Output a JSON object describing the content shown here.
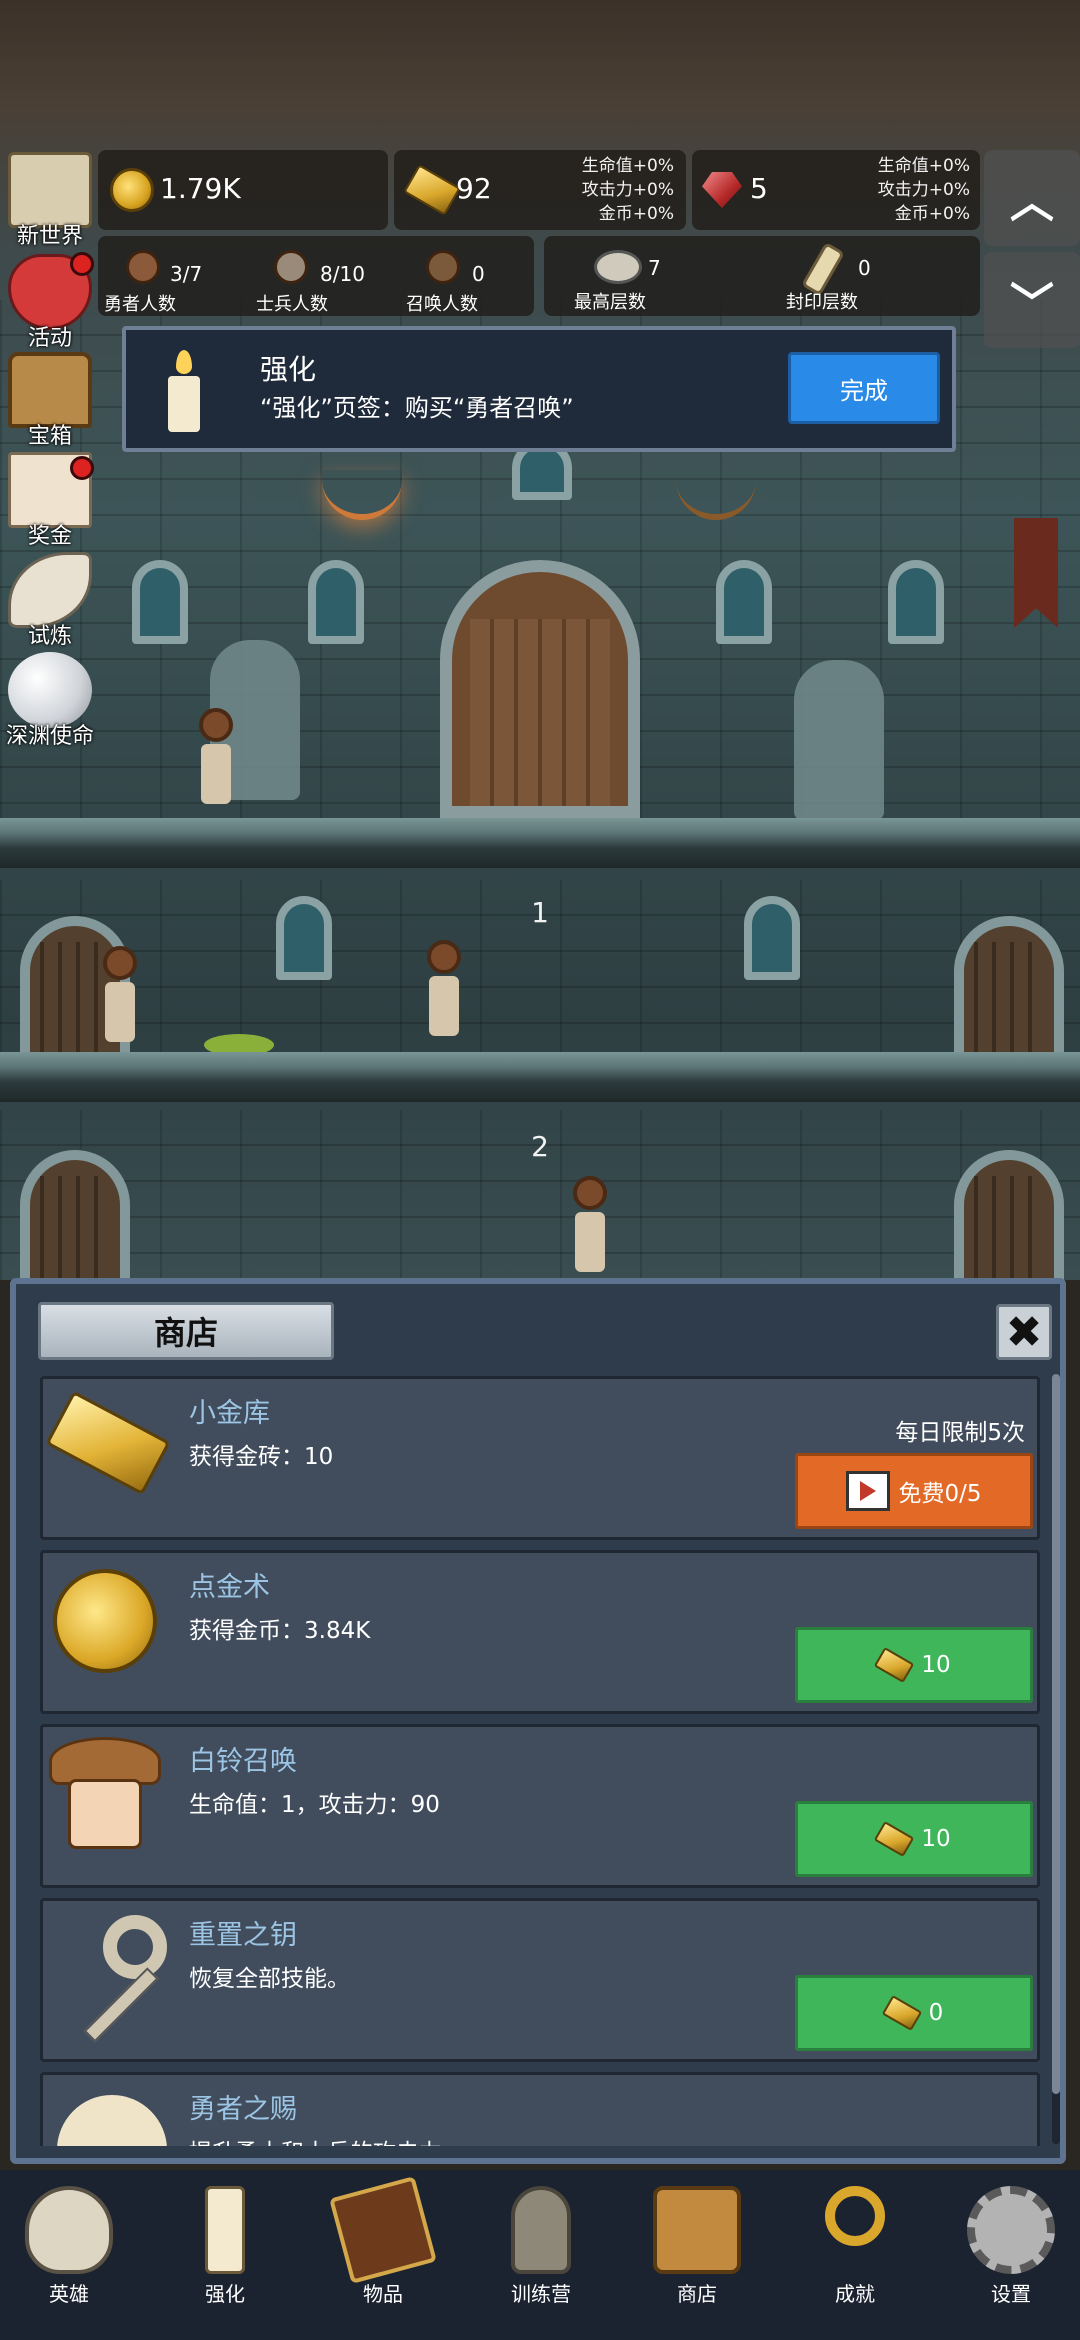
{
  "hud": {
    "gold_coins": "1.79K",
    "gold_bars": "92",
    "gold_bars_bonus": [
      "生命值+0%",
      "攻击力+0%",
      "金币+0%"
    ],
    "gems": "5",
    "gems_bonus": [
      "生命值+0%",
      "攻击力+0%",
      "金币+0%"
    ],
    "counts": [
      {
        "label": "勇者人数",
        "value": "3/7"
      },
      {
        "label": "士兵人数",
        "value": "8/10"
      },
      {
        "label": "召唤人数",
        "value": "0"
      },
      {
        "label": "最高层数",
        "value": "7"
      },
      {
        "label": "封印层数",
        "value": "0"
      }
    ],
    "arrow_up": "︿",
    "arrow_down": "﹀"
  },
  "side_menu": [
    {
      "label": "新世界",
      "icon": "map-scroll-icon",
      "badge": false
    },
    {
      "label": "活动",
      "icon": "heart-icon",
      "badge": true
    },
    {
      "label": "宝箱",
      "icon": "treasure-chest-icon",
      "badge": false
    },
    {
      "label": "奖金",
      "icon": "envelope-icon",
      "badge": true
    },
    {
      "label": "试炼",
      "icon": "feather-icon",
      "badge": false
    },
    {
      "label": "深渊使命",
      "icon": "pearl-icon",
      "badge": false
    }
  ],
  "quest": {
    "title": "强化",
    "description": "“强化”页签：购买“勇者召唤”",
    "button": "完成"
  },
  "floors": [
    "1",
    "2"
  ],
  "shop": {
    "title": "商店",
    "close": "✖",
    "items": [
      {
        "name": "小金库",
        "desc": "获得金砖：10",
        "limit": "每日限制5次",
        "button": "免费0/5",
        "button_type": "video"
      },
      {
        "name": "点金术",
        "desc": "获得金币：3.84K",
        "limit": "",
        "button": "10",
        "button_type": "goldbar"
      },
      {
        "name": "白铃召唤",
        "desc": "生命值：1，攻击力：90",
        "limit": "",
        "button": "10",
        "button_type": "goldbar"
      },
      {
        "name": "重置之钥",
        "desc": "恢复全部技能。",
        "limit": "",
        "button": "0",
        "button_type": "goldbar"
      },
      {
        "name": "勇者之赐",
        "desc": "提升勇士和士兵的攻击力。",
        "limit": "",
        "button": "",
        "button_type": "goldbar"
      }
    ]
  },
  "bottom_nav": [
    {
      "label": "英雄",
      "icon": "skull-icon"
    },
    {
      "label": "强化",
      "icon": "candle-icon"
    },
    {
      "label": "物品",
      "icon": "book-icon"
    },
    {
      "label": "训练营",
      "icon": "lantern-icon"
    },
    {
      "label": "商店",
      "icon": "beer-mug-icon"
    },
    {
      "label": "成就",
      "icon": "golden-key-icon"
    },
    {
      "label": "设置",
      "icon": "gear-icon"
    }
  ],
  "colors": {
    "done_button": "#2a8ae8",
    "buy_button": "#3fb65a",
    "video_button": "#e26a26",
    "item_name": "#9cc4e4"
  }
}
